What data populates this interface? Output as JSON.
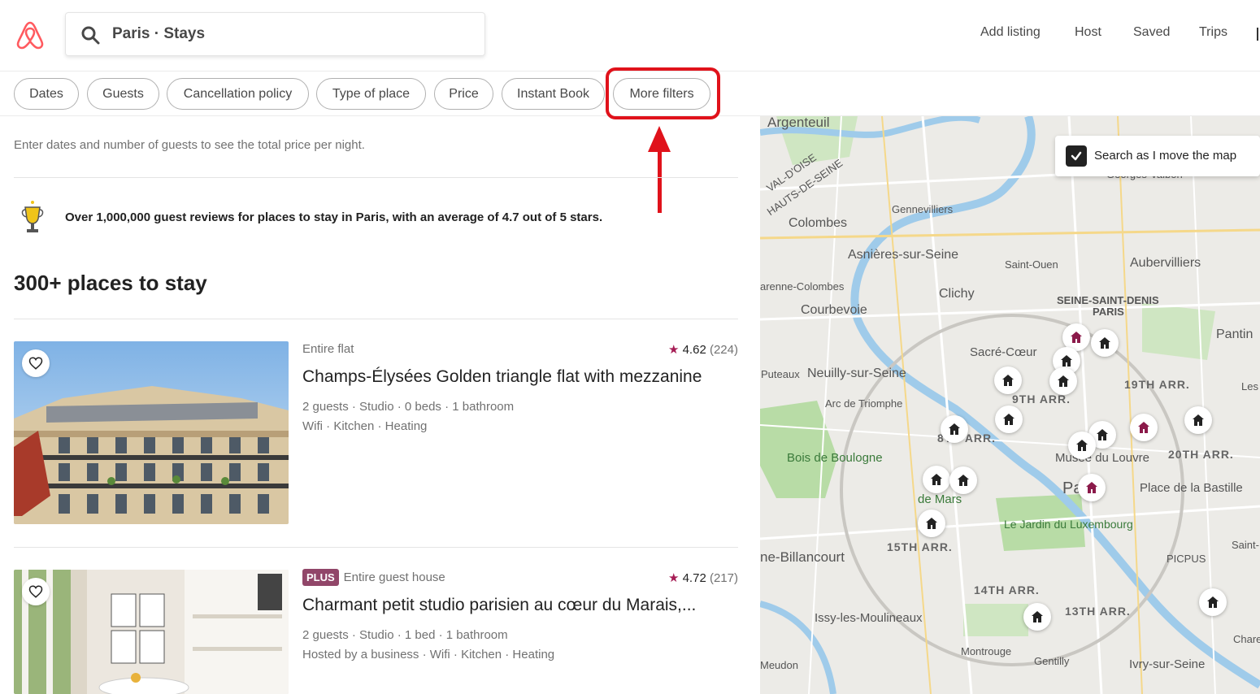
{
  "header": {
    "search_text": "Paris · Stays",
    "nav": [
      "Add listing",
      "Host",
      "Saved",
      "Trips"
    ]
  },
  "filters": [
    "Dates",
    "Guests",
    "Cancellation policy",
    "Type of place",
    "Price",
    "Instant Book",
    "More filters"
  ],
  "hint": "Enter dates and number of guests to see the total price per night.",
  "reviews_banner": "Over 1,000,000 guest reviews for places to stay in Paris, with an average of 4.7 out of 5 stars.",
  "places_title": "300+ places to stay",
  "listings": [
    {
      "type": "Entire flat",
      "rating": "4.62",
      "reviews": "(224)",
      "title": "Champs-Élysées Golden triangle flat with mezzanine",
      "details": "2 guests · Studio · 0 beds · 1 bathroom",
      "amenities": "Wifi · Kitchen · Heating"
    },
    {
      "badge": "PLUS",
      "type": "Entire guest house",
      "rating": "4.72",
      "reviews": "(217)",
      "title": "Charmant petit studio parisien au cœur du Marais,...",
      "details": "2 guests · Studio · 1 bed · 1 bathroom",
      "amenities": "Hosted by a business · Wifi · Kitchen · Heating"
    }
  ],
  "map": {
    "search_as_move": "Search as I move the map",
    "labels": {
      "argenteuil": "Argenteuil",
      "colombes": "Colombes",
      "gennevilliers": "Gennevilliers",
      "asnieres": "Asnières-sur-Seine",
      "saint_ouen": "Saint-Ouen",
      "aubervilliers": "Aubervilliers",
      "clichy": "Clichy",
      "garenne": "arenne-Colombes",
      "courbevoie": "Courbevoie",
      "seine_st_denis": "SEINE-SAINT-DENIS",
      "paris_small": "PARIS",
      "pantin": "Pantin",
      "sacre_coeur": "Sacré-Cœur",
      "puteaux": "Puteaux",
      "neuilly": "Neuilly-sur-Seine",
      "arr19": "19TH ARR.",
      "arc": "Arc de Triomphe",
      "arr8": "8TH ARR.",
      "arr9": "9TH ARR.",
      "arr20": "20TH ARR.",
      "musee": "Musée du Louvre",
      "bois": "Bois de Boulogne",
      "champ": "de Mars",
      "paris": "Paris",
      "bastille": "Place de la Bastille",
      "jardin": "Le Jardin du Luxembourg",
      "arr15": "15TH ARR.",
      "billancourt": "ne-Billancourt",
      "arr14": "14TH ARR.",
      "arr13": "13TH ARR.",
      "issy": "Issy-les-Moulineaux",
      "montrouge": "Montrouge",
      "gentilly": "Gentilly",
      "ivry": "Ivry-sur-Seine",
      "meudon": "Meudon",
      "charenton": "Charenton",
      "saint_m": "Saint-",
      "picpus": "PICPUS",
      "val_doise": "VAL-D'OISE",
      "hauts": "HAUTS-DE-SEINE",
      "georges": "Georges-Valbon",
      "les": "Les"
    }
  },
  "colors": {
    "brand": "#FF5A5F",
    "highlight": "#E0121B",
    "plus": "#914669"
  }
}
